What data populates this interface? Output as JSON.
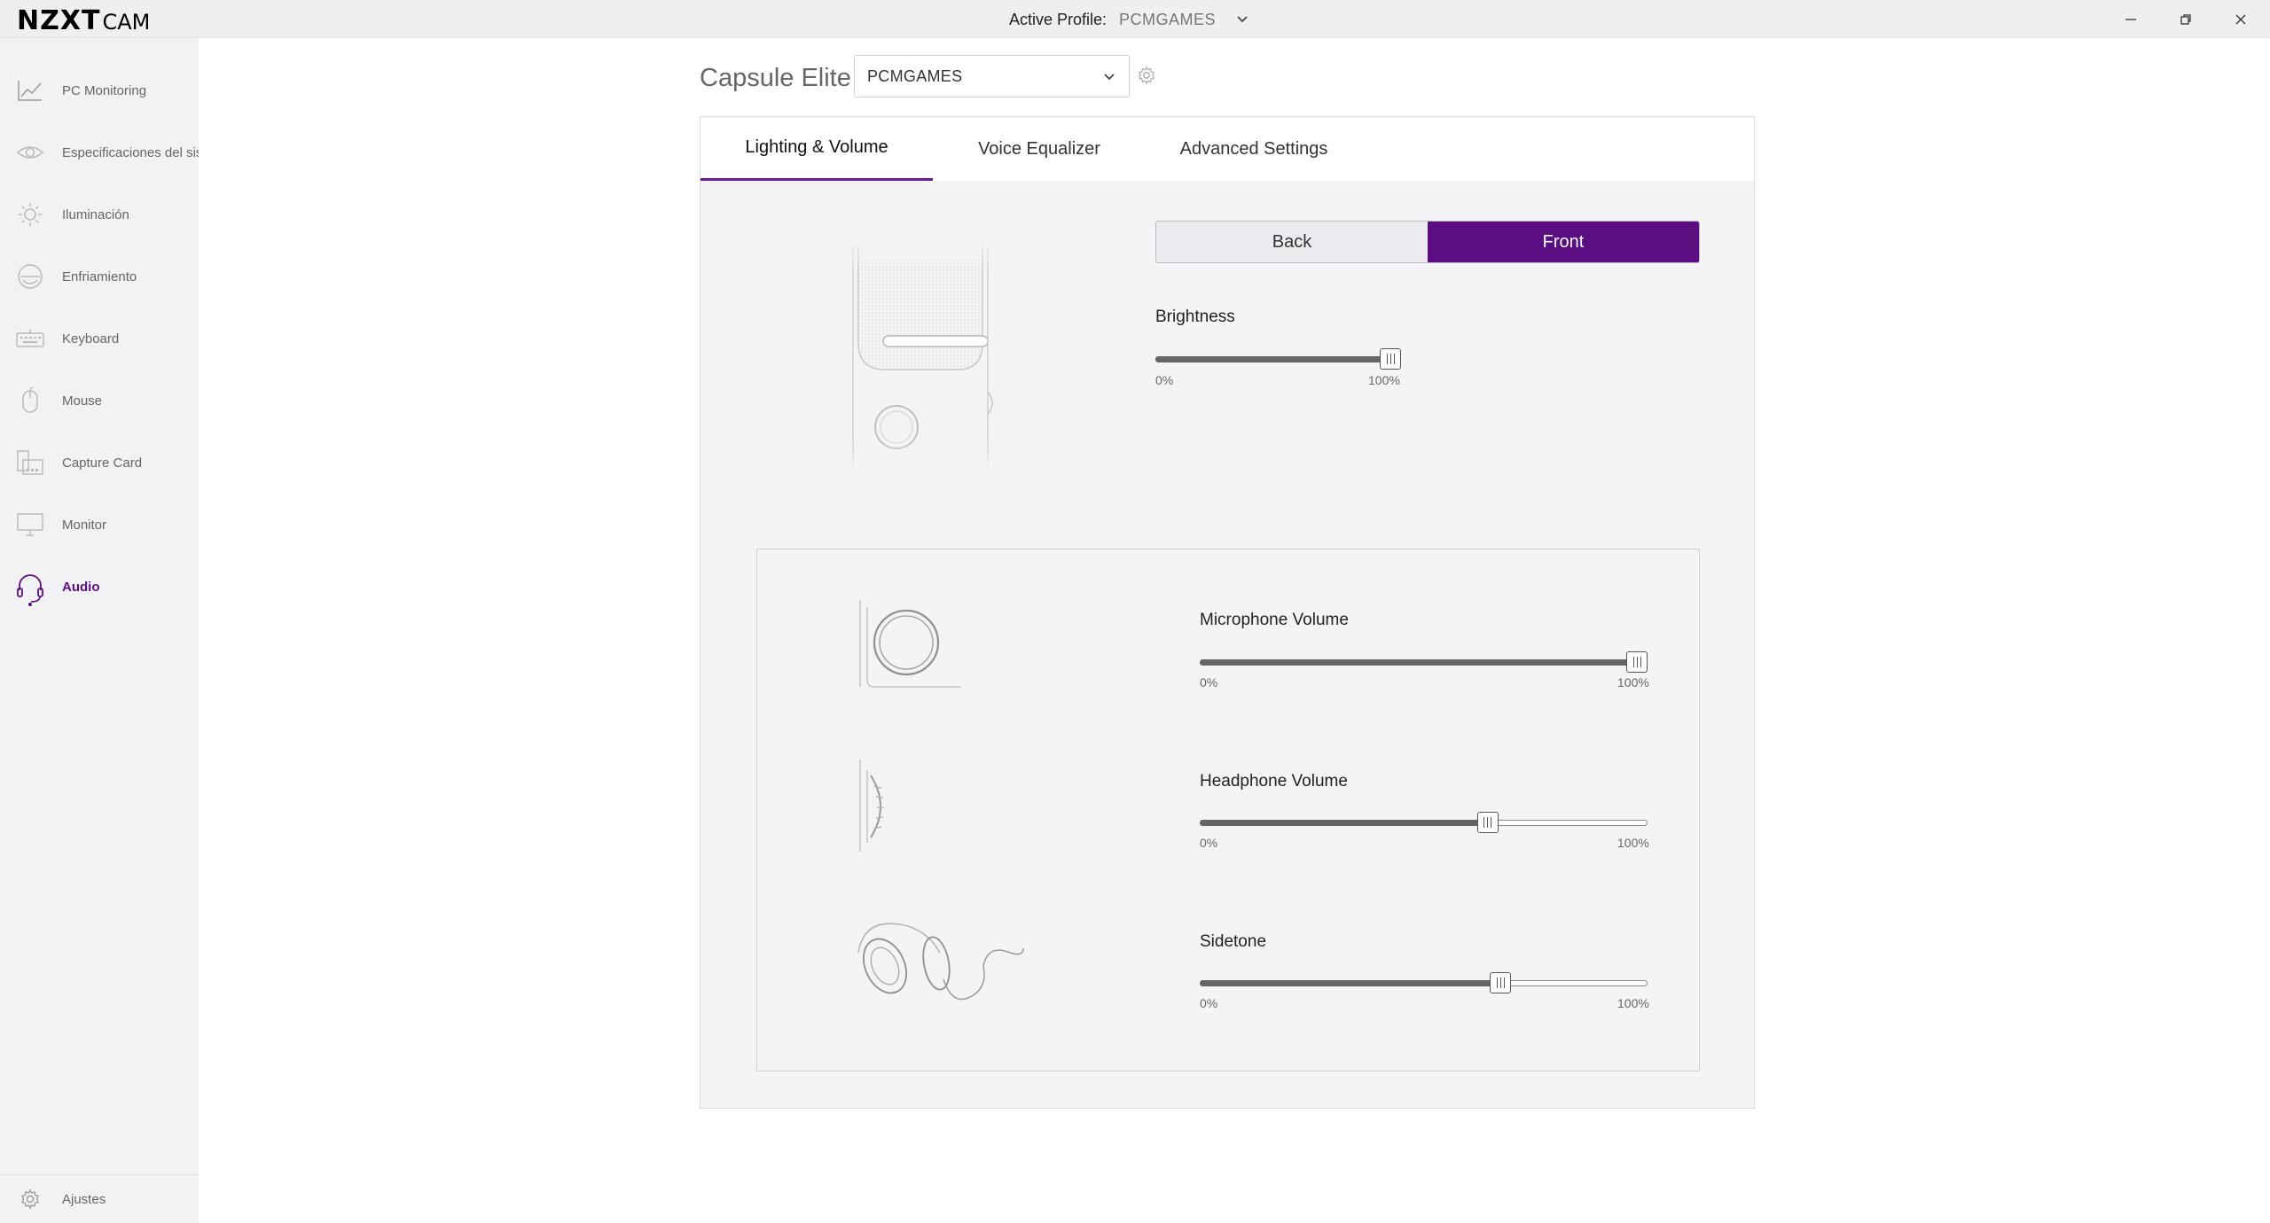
{
  "app": {
    "logo_main": "NZXT",
    "logo_sub": "CAM",
    "active_profile_label": "Active Profile:",
    "active_profile_value": "PCMGAMES"
  },
  "sidebar": {
    "items": [
      {
        "label": "PC Monitoring",
        "icon": "line-chart-icon"
      },
      {
        "label": "Especificaciones del sistema",
        "icon": "eye-icon"
      },
      {
        "label": "Iluminación",
        "icon": "sun-icon"
      },
      {
        "label": "Enfriamiento",
        "icon": "fan-icon"
      },
      {
        "label": "Keyboard",
        "icon": "keyboard-icon"
      },
      {
        "label": "Mouse",
        "icon": "mouse-icon"
      },
      {
        "label": "Capture Card",
        "icon": "capture-card-icon"
      },
      {
        "label": "Monitor",
        "icon": "monitor-icon"
      },
      {
        "label": "Audio",
        "icon": "headset-icon",
        "active": true
      }
    ],
    "settings_label": "Ajustes"
  },
  "device": {
    "title": "Capsule Elite",
    "profile_selected": "PCMGAMES"
  },
  "tabs": [
    {
      "label": "Lighting & Volume",
      "active": true
    },
    {
      "label": "Voice Equalizer"
    },
    {
      "label": "Advanced Settings"
    }
  ],
  "lighting": {
    "side_options": [
      "Back",
      "Front"
    ],
    "selected_side": "Front",
    "brightness_label": "Brightness",
    "brightness_value_pct": 100,
    "min_label": "0%",
    "max_label": "100%"
  },
  "volume": {
    "microphone_label": "Microphone Volume",
    "microphone_value_pct": 100,
    "headphone_label": "Headphone Volume",
    "headphone_value_pct": 65,
    "sidetone_label": "Sidetone",
    "sidetone_value_pct": 68,
    "min_label": "0%",
    "max_label": "100%"
  },
  "colors": {
    "accent": "#5b0d82",
    "accent_underline": "#6a1b9a"
  }
}
